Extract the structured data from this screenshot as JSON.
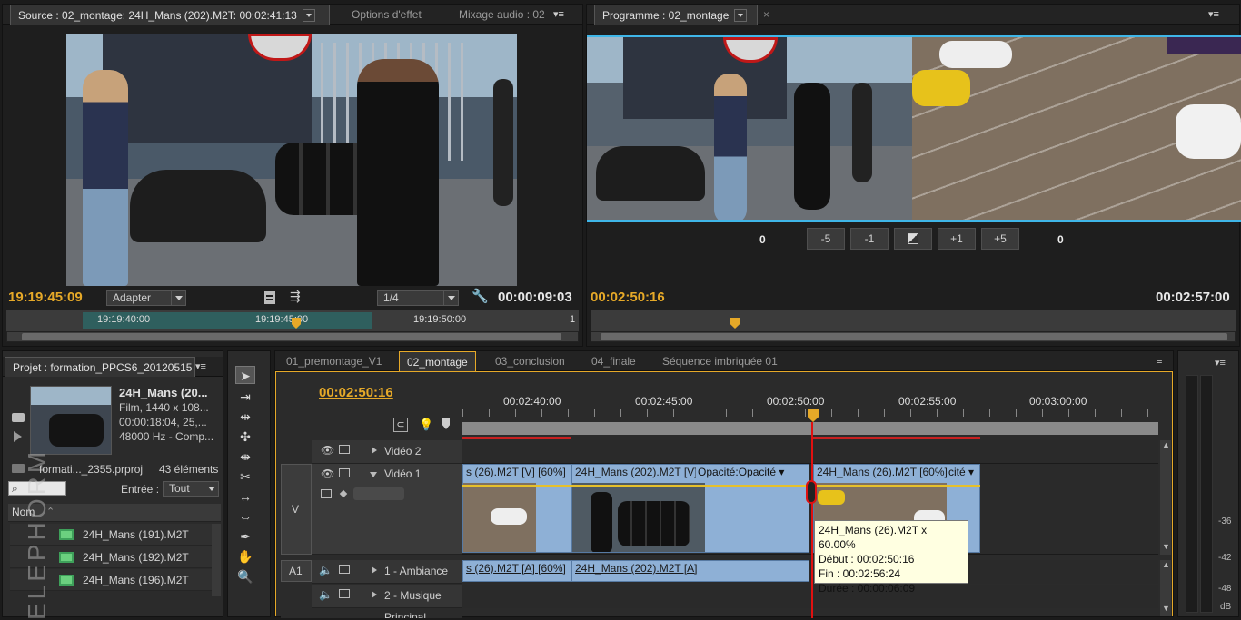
{
  "source_monitor": {
    "tab_source": "Source : 02_montage: 24H_Mans (202).M2T: 00:02:41:13",
    "tab_effects": "Options d'effet",
    "tab_audio": "Mixage audio : 02",
    "timecode_current": "19:19:45:09",
    "fit_select": "Adapter",
    "resolution_select": "1/4",
    "duration": "00:00:09:03",
    "ruler_labels": [
      "19:19:40:00",
      "19:19:45:00",
      "19:19:50:00"
    ],
    "ruler_end_mark": "1"
  },
  "program_monitor": {
    "tab_title": "Programme : 02_montage",
    "left_value": "0",
    "right_value": "0",
    "trim_buttons": [
      "-5",
      "-1",
      "",
      "+1",
      "+5"
    ],
    "timecode_current": "00:02:50:16",
    "duration": "00:02:57:00"
  },
  "project": {
    "tab_title": "Projet : formation_PPCS6_20120515",
    "preview_name": "24H_Mans (20...",
    "preview_line1": "Film, 1440 x 108...",
    "preview_line2": "00:00:18:04, 25,...",
    "preview_line3": "48000 Hz - Comp...",
    "project_file": "formati..._2355.prproj",
    "item_count": "43 éléments",
    "entry_label": "Entrée :",
    "entry_select": "Tout",
    "column_name": "Nom",
    "items": [
      "24H_Mans (191).M2T",
      "24H_Mans (192).M2T",
      "24H_Mans (196).M2T"
    ]
  },
  "timeline": {
    "tabs": [
      "01_premontage_V1",
      "02_montage",
      "03_conclusion",
      "04_finale",
      "Séquence imbriquée 01"
    ],
    "timecode": "00:02:50:16",
    "ruler_labels": [
      "00:02:40:00",
      "00:02:45:00",
      "00:02:50:00",
      "00:02:55:00",
      "00:03:00:00"
    ],
    "tracks": {
      "video2": "Vidéo 2",
      "video1": "Vidéo 1",
      "v_label": "V",
      "a1_label": "A1",
      "audio1": "1 - Ambiance",
      "audio2": "2 - Musique",
      "master": "Principal"
    },
    "clips_v1": [
      "s (26).M2T [V] [60%]",
      "24H_Mans (202).M2T [V]",
      "Opacité:Opacité",
      "24H_Mans (26).M2T [60%]",
      "cité"
    ],
    "clips_a1": [
      "s (26).M2T [A] [60%]",
      "24H_Mans (202).M2T [A]"
    ],
    "tooltip": {
      "line1": "24H_Mans (26).M2T x 60.00%",
      "line2": "Début : 00:02:50:16",
      "line3": "Fin : 00:02:56:24",
      "line4": "Durée : 00:00:06:09"
    }
  },
  "meters": {
    "labels": [
      "-36",
      "-42",
      "-48",
      "dB"
    ]
  },
  "watermark": "ELEPHORM",
  "colors": {
    "timecode_yellow": "#e6a928",
    "playhead_red": "#e01010",
    "clip_blue": "#8eb0d6",
    "selection_blue": "#3fb6e8",
    "tooltip_bg": "#ffffe1"
  }
}
